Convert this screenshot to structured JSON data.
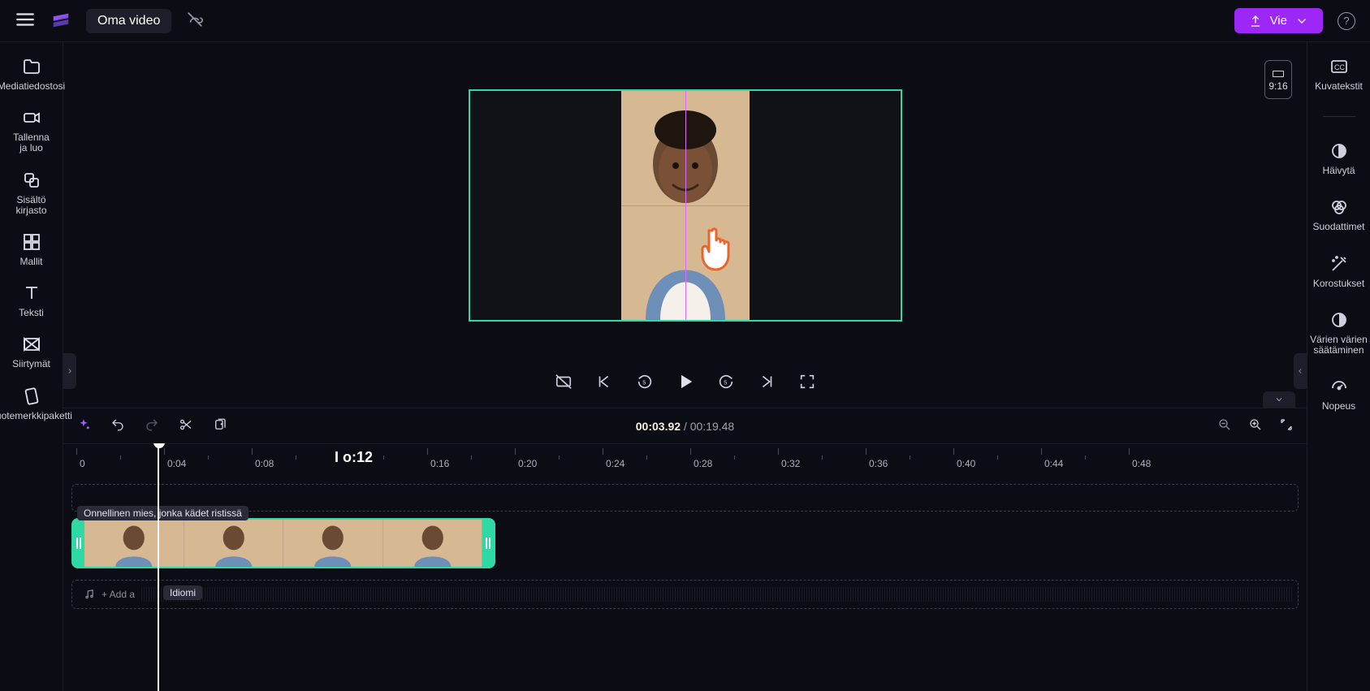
{
  "topbar": {
    "project_title": "Oma video",
    "export_label": "Vie"
  },
  "left_sidebar": {
    "items": [
      {
        "label": "Mediatiedostosi"
      },
      {
        "label": "Tallenna\nja luo"
      },
      {
        "label": "Sisältö\nkirjasto"
      },
      {
        "label": "Mallit"
      },
      {
        "label": "Teksti"
      },
      {
        "label": "Siirtymät"
      },
      {
        "label": "Tuotemerkkipaketti"
      }
    ]
  },
  "right_sidebar": {
    "items": [
      {
        "label": "Kuvatekstit"
      },
      {
        "label": "Häivytä"
      },
      {
        "label": "Suodattimet"
      },
      {
        "label": "Korostukset"
      },
      {
        "label": "Värien värien\nsäätäminen"
      },
      {
        "label": "Nopeus"
      }
    ]
  },
  "preview": {
    "aspect_label": "9:16"
  },
  "timeline": {
    "current_time": "00:03.92",
    "total_time": "00:19.48",
    "ticks": [
      "0",
      "0:04",
      "0:08",
      "0:12",
      "0:16",
      "0:20",
      "0:24",
      "0:28",
      "0:32",
      "0:36",
      "0:40",
      "0:44",
      "0:48"
    ],
    "big_tick_label": "I o:12",
    "clip_title": "Onnellinen mies, jonka kädet ristissä",
    "audio_placeholder": "+ Add a",
    "tooltip": "Idiomi"
  }
}
